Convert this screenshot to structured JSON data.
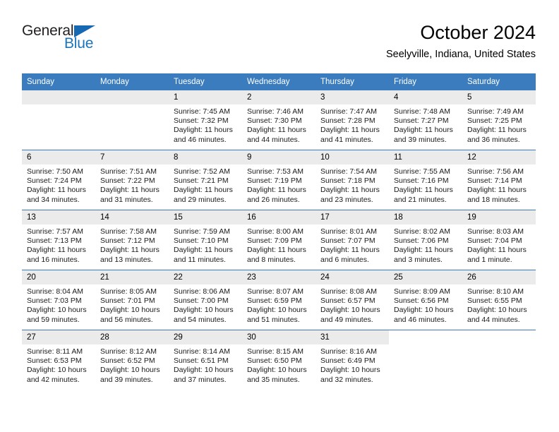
{
  "brand": {
    "name_top": "General",
    "name_bottom": "Blue",
    "accent_color": "#1b75bc",
    "triangle_color": "#1668b3",
    "triangle_icon": "triangle-icon"
  },
  "header": {
    "title": "October 2024",
    "subtitle": "Seelyville, Indiana, United States"
  },
  "calendar": {
    "header_bg": "#3a7cbe",
    "daynum_bg": "#ebebeb",
    "weekdays": [
      "Sunday",
      "Monday",
      "Tuesday",
      "Wednesday",
      "Thursday",
      "Friday",
      "Saturday"
    ],
    "weeks": [
      [
        {
          "day": "",
          "sunrise": "",
          "sunset": "",
          "daylight": "",
          "empty": true
        },
        {
          "day": "",
          "sunrise": "",
          "sunset": "",
          "daylight": "",
          "empty": true
        },
        {
          "day": "1",
          "sunrise": "Sunrise: 7:45 AM",
          "sunset": "Sunset: 7:32 PM",
          "daylight": "Daylight: 11 hours and 46 minutes."
        },
        {
          "day": "2",
          "sunrise": "Sunrise: 7:46 AM",
          "sunset": "Sunset: 7:30 PM",
          "daylight": "Daylight: 11 hours and 44 minutes."
        },
        {
          "day": "3",
          "sunrise": "Sunrise: 7:47 AM",
          "sunset": "Sunset: 7:28 PM",
          "daylight": "Daylight: 11 hours and 41 minutes."
        },
        {
          "day": "4",
          "sunrise": "Sunrise: 7:48 AM",
          "sunset": "Sunset: 7:27 PM",
          "daylight": "Daylight: 11 hours and 39 minutes."
        },
        {
          "day": "5",
          "sunrise": "Sunrise: 7:49 AM",
          "sunset": "Sunset: 7:25 PM",
          "daylight": "Daylight: 11 hours and 36 minutes."
        }
      ],
      [
        {
          "day": "6",
          "sunrise": "Sunrise: 7:50 AM",
          "sunset": "Sunset: 7:24 PM",
          "daylight": "Daylight: 11 hours and 34 minutes."
        },
        {
          "day": "7",
          "sunrise": "Sunrise: 7:51 AM",
          "sunset": "Sunset: 7:22 PM",
          "daylight": "Daylight: 11 hours and 31 minutes."
        },
        {
          "day": "8",
          "sunrise": "Sunrise: 7:52 AM",
          "sunset": "Sunset: 7:21 PM",
          "daylight": "Daylight: 11 hours and 29 minutes."
        },
        {
          "day": "9",
          "sunrise": "Sunrise: 7:53 AM",
          "sunset": "Sunset: 7:19 PM",
          "daylight": "Daylight: 11 hours and 26 minutes."
        },
        {
          "day": "10",
          "sunrise": "Sunrise: 7:54 AM",
          "sunset": "Sunset: 7:18 PM",
          "daylight": "Daylight: 11 hours and 23 minutes."
        },
        {
          "day": "11",
          "sunrise": "Sunrise: 7:55 AM",
          "sunset": "Sunset: 7:16 PM",
          "daylight": "Daylight: 11 hours and 21 minutes."
        },
        {
          "day": "12",
          "sunrise": "Sunrise: 7:56 AM",
          "sunset": "Sunset: 7:14 PM",
          "daylight": "Daylight: 11 hours and 18 minutes."
        }
      ],
      [
        {
          "day": "13",
          "sunrise": "Sunrise: 7:57 AM",
          "sunset": "Sunset: 7:13 PM",
          "daylight": "Daylight: 11 hours and 16 minutes."
        },
        {
          "day": "14",
          "sunrise": "Sunrise: 7:58 AM",
          "sunset": "Sunset: 7:12 PM",
          "daylight": "Daylight: 11 hours and 13 minutes."
        },
        {
          "day": "15",
          "sunrise": "Sunrise: 7:59 AM",
          "sunset": "Sunset: 7:10 PM",
          "daylight": "Daylight: 11 hours and 11 minutes."
        },
        {
          "day": "16",
          "sunrise": "Sunrise: 8:00 AM",
          "sunset": "Sunset: 7:09 PM",
          "daylight": "Daylight: 11 hours and 8 minutes."
        },
        {
          "day": "17",
          "sunrise": "Sunrise: 8:01 AM",
          "sunset": "Sunset: 7:07 PM",
          "daylight": "Daylight: 11 hours and 6 minutes."
        },
        {
          "day": "18",
          "sunrise": "Sunrise: 8:02 AM",
          "sunset": "Sunset: 7:06 PM",
          "daylight": "Daylight: 11 hours and 3 minutes."
        },
        {
          "day": "19",
          "sunrise": "Sunrise: 8:03 AM",
          "sunset": "Sunset: 7:04 PM",
          "daylight": "Daylight: 11 hours and 1 minute."
        }
      ],
      [
        {
          "day": "20",
          "sunrise": "Sunrise: 8:04 AM",
          "sunset": "Sunset: 7:03 PM",
          "daylight": "Daylight: 10 hours and 59 minutes."
        },
        {
          "day": "21",
          "sunrise": "Sunrise: 8:05 AM",
          "sunset": "Sunset: 7:01 PM",
          "daylight": "Daylight: 10 hours and 56 minutes."
        },
        {
          "day": "22",
          "sunrise": "Sunrise: 8:06 AM",
          "sunset": "Sunset: 7:00 PM",
          "daylight": "Daylight: 10 hours and 54 minutes."
        },
        {
          "day": "23",
          "sunrise": "Sunrise: 8:07 AM",
          "sunset": "Sunset: 6:59 PM",
          "daylight": "Daylight: 10 hours and 51 minutes."
        },
        {
          "day": "24",
          "sunrise": "Sunrise: 8:08 AM",
          "sunset": "Sunset: 6:57 PM",
          "daylight": "Daylight: 10 hours and 49 minutes."
        },
        {
          "day": "25",
          "sunrise": "Sunrise: 8:09 AM",
          "sunset": "Sunset: 6:56 PM",
          "daylight": "Daylight: 10 hours and 46 minutes."
        },
        {
          "day": "26",
          "sunrise": "Sunrise: 8:10 AM",
          "sunset": "Sunset: 6:55 PM",
          "daylight": "Daylight: 10 hours and 44 minutes."
        }
      ],
      [
        {
          "day": "27",
          "sunrise": "Sunrise: 8:11 AM",
          "sunset": "Sunset: 6:53 PM",
          "daylight": "Daylight: 10 hours and 42 minutes."
        },
        {
          "day": "28",
          "sunrise": "Sunrise: 8:12 AM",
          "sunset": "Sunset: 6:52 PM",
          "daylight": "Daylight: 10 hours and 39 minutes."
        },
        {
          "day": "29",
          "sunrise": "Sunrise: 8:14 AM",
          "sunset": "Sunset: 6:51 PM",
          "daylight": "Daylight: 10 hours and 37 minutes."
        },
        {
          "day": "30",
          "sunrise": "Sunrise: 8:15 AM",
          "sunset": "Sunset: 6:50 PM",
          "daylight": "Daylight: 10 hours and 35 minutes."
        },
        {
          "day": "31",
          "sunrise": "Sunrise: 8:16 AM",
          "sunset": "Sunset: 6:49 PM",
          "daylight": "Daylight: 10 hours and 32 minutes."
        },
        {
          "day": "",
          "sunrise": "",
          "sunset": "",
          "daylight": "",
          "blank": true
        },
        {
          "day": "",
          "sunrise": "",
          "sunset": "",
          "daylight": "",
          "blank": true
        }
      ]
    ]
  }
}
